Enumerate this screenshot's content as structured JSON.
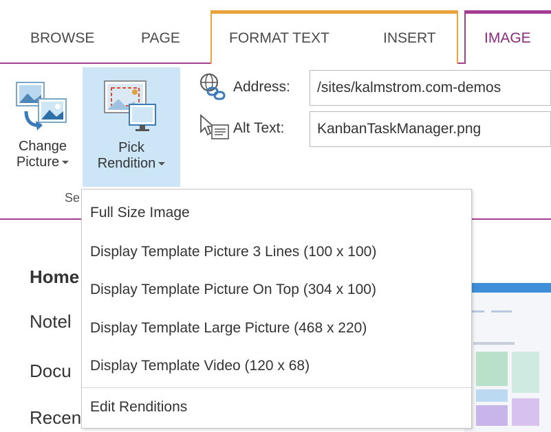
{
  "tabs": {
    "browse": "BROWSE",
    "page": "PAGE",
    "format_text": "FORMAT TEXT",
    "insert": "INSERT",
    "image": "IMAGE"
  },
  "colors": {
    "accent": "#a23d91",
    "context_orange": "#e8a33b",
    "selected_button": "#cde6f7"
  },
  "ribbon": {
    "change_picture": {
      "line1": "Change",
      "line2": "Picture",
      "icon": "change-picture-icon"
    },
    "pick_rendition": {
      "line1": "Pick",
      "line2": "Rendition",
      "icon": "pick-rendition-icon"
    },
    "group_label": "Se",
    "address": {
      "label": "Address:",
      "value": "/sites/kalmstrom.com-demos",
      "icon": "globe-link-icon"
    },
    "alt_text": {
      "label": "Alt Text:",
      "value": "KanbanTaskManager.png",
      "icon": "cursor-text-icon"
    }
  },
  "nav": [
    "Home",
    "Notel",
    "Docu",
    "Recen"
  ],
  "menu": {
    "items": [
      "Full Size Image",
      "Display Template Picture 3 Lines (100 x 100)",
      "Display Template Picture On Top (304 x 100)",
      "Display Template Large Picture (468 x 220)",
      "Display Template Video (120 x 68)"
    ],
    "footer": "Edit Renditions"
  }
}
